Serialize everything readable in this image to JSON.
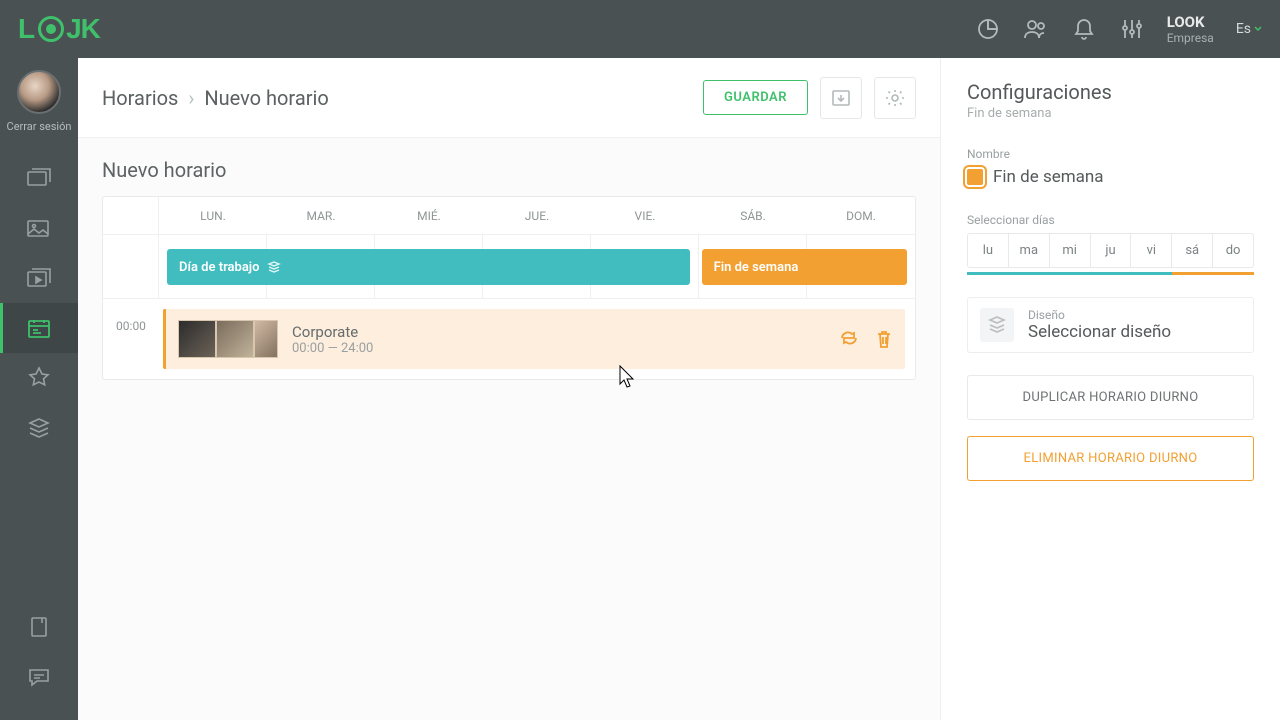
{
  "topbar": {
    "brand_name": "LOOK",
    "brand_sub": "Empresa",
    "language": "Es"
  },
  "leftrail": {
    "logout_label": "Cerrar sesión"
  },
  "header": {
    "crumb_root": "Horarios",
    "crumb_current": "Nuevo horario",
    "save_button": "GUARDAR"
  },
  "main": {
    "section_title": "Nuevo horario",
    "days": [
      "LUN.",
      "MAR.",
      "MIÉ.",
      "JUE.",
      "VIE.",
      "SÁB.",
      "DOM."
    ],
    "blocks": {
      "workday": "Día de trabajo",
      "weekend": "Fin de semana"
    },
    "slot": {
      "start_mark": "00:00",
      "title": "Corporate",
      "range": "00:00 — 24:00"
    }
  },
  "config": {
    "title": "Configuraciones",
    "subtitle": "Fin de semana",
    "name_label": "Nombre",
    "name_value": "Fin de semana",
    "select_days_label": "Seleccionar días",
    "day_abbrev": [
      "lu",
      "ma",
      "mi",
      "ju",
      "vi",
      "sá",
      "do"
    ],
    "design_label": "Diseño",
    "design_value": "Seleccionar diseño",
    "duplicate_button": "DUPLICAR HORARIO DIURNO",
    "delete_button": "ELIMINAR HORARIO DIURNO"
  }
}
